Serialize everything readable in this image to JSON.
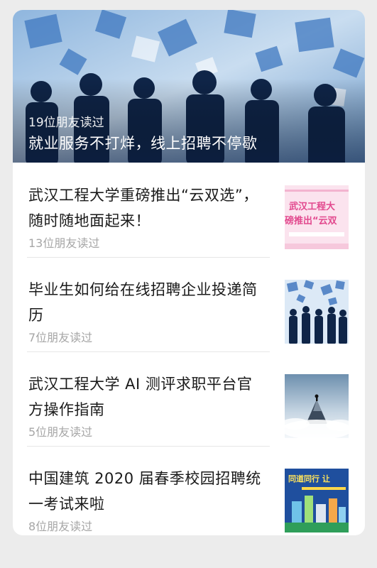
{
  "hero": {
    "read_count": "19位朋友读过",
    "title": "就业服务不打烊，线上招聘不停歇"
  },
  "articles": [
    {
      "title": "武汉工程大学重磅推出“云双选”，随时随地面起来！",
      "read_count": "13位朋友读过",
      "thumb": {
        "line1": "武汉工程大",
        "line2": "磅推出“云双"
      }
    },
    {
      "title": "毕业生如何给在线招聘企业投递简历",
      "read_count": "7位朋友读过"
    },
    {
      "title": "武汉工程大学 AI 测评求职平台官方操作指南",
      "read_count": "5位朋友读过"
    },
    {
      "title": "中国建筑 2020 届春季校园招聘统一考试来啦",
      "read_count": "8位朋友读过",
      "thumb": {
        "line1": "同道同行 让"
      }
    }
  ],
  "colors": {
    "background": "#ececec",
    "card": "#ffffff",
    "title_text": "#1a1a1a",
    "meta_text": "#a6a6a6"
  }
}
